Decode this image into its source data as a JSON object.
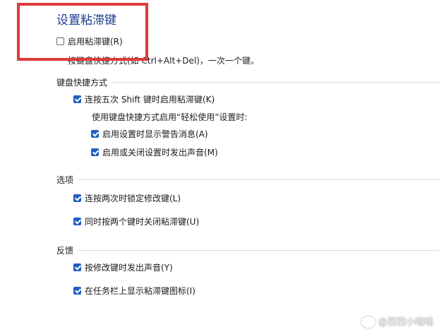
{
  "dialog": {
    "title": "设置粘滞键",
    "enable_label": "启用粘滞键(R)",
    "description_partial": "按键盘快捷方式(如 Ctrl+Alt+Del)，一次一个键。"
  },
  "sections": {
    "shortcut": {
      "title": "键盘快捷方式",
      "shift_label": "连按五次 Shift 键时启用粘滞键(K)",
      "subheading": "使用键盘快捷方式启用“轻松使用”设置时:",
      "warning_label": "启用设置时显示警告消息(A)",
      "sound_label": "启用或关闭设置时发出声音(M)"
    },
    "options": {
      "title": "选项",
      "lock_label": "连按两次时锁定修改键(L)",
      "close_label": "同时按两个键时关闭粘滞键(U)"
    },
    "feedback": {
      "title": "反馈",
      "beep_label": "按修改键时发出声音(Y)",
      "taskbar_label": "在任务栏上显示粘滞键图标(I)"
    }
  },
  "checkbox_states": {
    "enable": false,
    "shift": true,
    "warning": true,
    "sound": true,
    "lock": true,
    "close": true,
    "beep": true,
    "taskbar": true
  },
  "colors": {
    "accent": "#1f5fbf",
    "title": "#1b3f8f",
    "highlight": "#e0393e"
  },
  "watermark": {
    "text": "@西西小喵喵"
  }
}
